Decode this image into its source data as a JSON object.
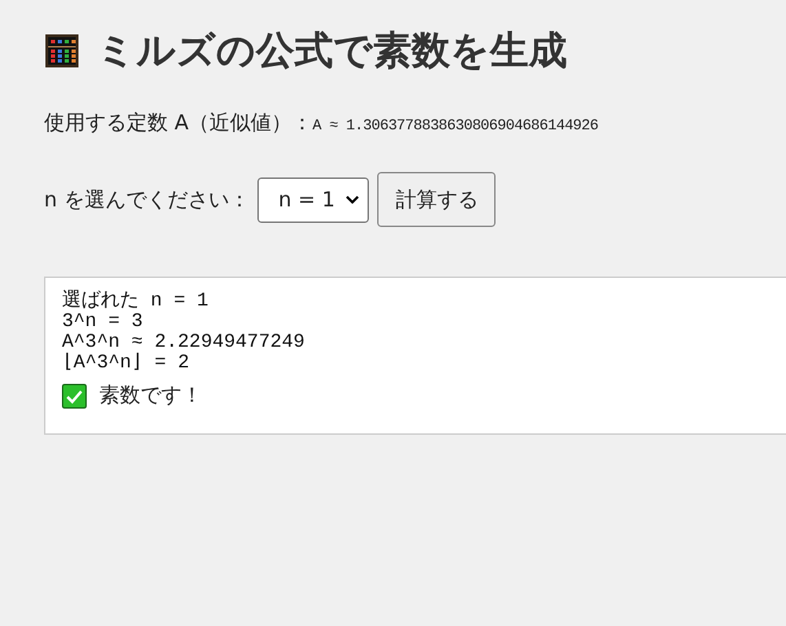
{
  "title": "ミルズの公式で素数を生成",
  "constant": {
    "label": "使用する定数 A（近似値）：",
    "value": "A ≈ 1.3063778838630806904686144926"
  },
  "picker": {
    "label": "n を選んでください：",
    "value": "n = 1",
    "button": "計算する"
  },
  "result": {
    "lines": [
      "選ばれた n = 1",
      "3^n = 3",
      "A^3^n ≈ 2.22949477249",
      "⌊A^3^n⌋ = 2"
    ],
    "prime": true,
    "verdict": "素数です！"
  }
}
